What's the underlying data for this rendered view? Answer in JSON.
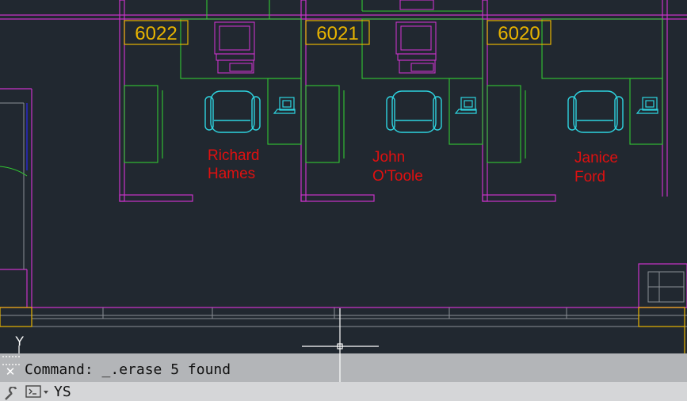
{
  "drawing": {
    "rooms": [
      {
        "number": "6022",
        "name_line1": "Richard",
        "name_line2": "Hames"
      },
      {
        "number": "6021",
        "name_line1": "John",
        "name_line2": "O'Toole"
      },
      {
        "number": "6020",
        "name_line1": "Janice",
        "name_line2": "Ford"
      }
    ],
    "ucs_label": "Y"
  },
  "command_line": {
    "history_text": "Command: _.erase 5 found",
    "input_text": "YS"
  },
  "colors": {
    "background": "#212830",
    "partition": "#c832c8",
    "furniture": "#32c832",
    "chair": "#2ed4e0",
    "room_tag": "#e8b400",
    "employee_name": "#e01010"
  },
  "icons": {
    "close": "close-icon",
    "customize": "wrench-icon",
    "prompt": "command-prompt-icon"
  }
}
